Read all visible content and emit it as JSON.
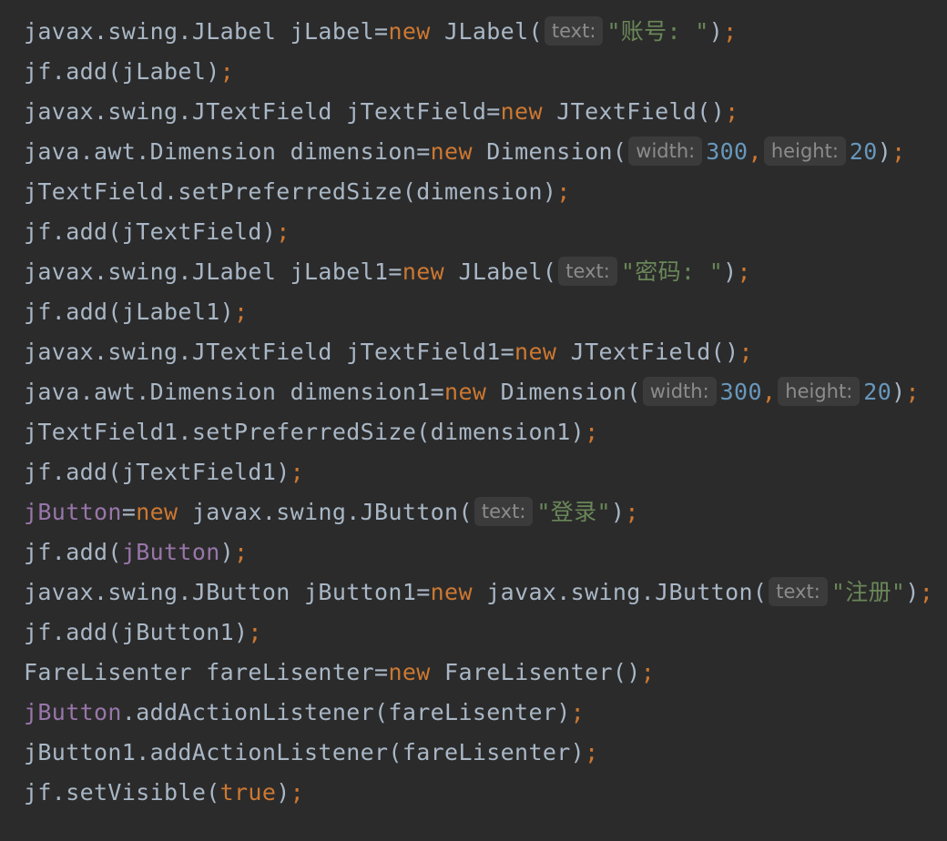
{
  "editor": {
    "lines": [
      [
        {
          "t": "code",
          "text": "javax.swing.JLabel jLabel=",
          "color": "#a9b7c6"
        },
        {
          "t": "code",
          "text": "new",
          "color": "#cc7832"
        },
        {
          "t": "code",
          "text": " JLabel(",
          "color": "#a9b7c6"
        },
        {
          "t": "hint",
          "text": "text:"
        },
        {
          "t": "code",
          "text": "\"账号: \"",
          "color": "#6a8759"
        },
        {
          "t": "code",
          "text": ")",
          "color": "#a9b7c6"
        },
        {
          "t": "code",
          "text": ";",
          "color": "#cc7832"
        }
      ],
      [
        {
          "t": "code",
          "text": "jf.add(jLabel)",
          "color": "#a9b7c6"
        },
        {
          "t": "code",
          "text": ";",
          "color": "#cc7832"
        }
      ],
      [
        {
          "t": "code",
          "text": "javax.swing.JTextField jTextField=",
          "color": "#a9b7c6"
        },
        {
          "t": "code",
          "text": "new",
          "color": "#cc7832"
        },
        {
          "t": "code",
          "text": " JTextField()",
          "color": "#a9b7c6"
        },
        {
          "t": "code",
          "text": ";",
          "color": "#cc7832"
        }
      ],
      [
        {
          "t": "code",
          "text": "java.awt.Dimension dimension=",
          "color": "#a9b7c6"
        },
        {
          "t": "code",
          "text": "new",
          "color": "#cc7832"
        },
        {
          "t": "code",
          "text": " Dimension(",
          "color": "#a9b7c6"
        },
        {
          "t": "hint",
          "text": "width:"
        },
        {
          "t": "code",
          "text": "300",
          "color": "#6897bb"
        },
        {
          "t": "code",
          "text": ",",
          "color": "#cc7832"
        },
        {
          "t": "hint",
          "text": "height:"
        },
        {
          "t": "code",
          "text": "20",
          "color": "#6897bb"
        },
        {
          "t": "code",
          "text": ")",
          "color": "#a9b7c6"
        },
        {
          "t": "code",
          "text": ";",
          "color": "#cc7832"
        }
      ],
      [
        {
          "t": "code",
          "text": "jTextField.setPreferredSize(dimension)",
          "color": "#a9b7c6"
        },
        {
          "t": "code",
          "text": ";",
          "color": "#cc7832"
        }
      ],
      [
        {
          "t": "code",
          "text": "jf.add(jTextField)",
          "color": "#a9b7c6"
        },
        {
          "t": "code",
          "text": ";",
          "color": "#cc7832"
        }
      ],
      [
        {
          "t": "code",
          "text": "javax.swing.JLabel jLabel1=",
          "color": "#a9b7c6"
        },
        {
          "t": "code",
          "text": "new",
          "color": "#cc7832"
        },
        {
          "t": "code",
          "text": " JLabel(",
          "color": "#a9b7c6"
        },
        {
          "t": "hint",
          "text": "text:"
        },
        {
          "t": "code",
          "text": "\"密码: \"",
          "color": "#6a8759"
        },
        {
          "t": "code",
          "text": ")",
          "color": "#a9b7c6"
        },
        {
          "t": "code",
          "text": ";",
          "color": "#cc7832"
        }
      ],
      [
        {
          "t": "code",
          "text": "jf.add(jLabel1)",
          "color": "#a9b7c6"
        },
        {
          "t": "code",
          "text": ";",
          "color": "#cc7832"
        }
      ],
      [
        {
          "t": "code",
          "text": "javax.swing.JTextField jTextField1=",
          "color": "#a9b7c6"
        },
        {
          "t": "code",
          "text": "new",
          "color": "#cc7832"
        },
        {
          "t": "code",
          "text": " JTextField()",
          "color": "#a9b7c6"
        },
        {
          "t": "code",
          "text": ";",
          "color": "#cc7832"
        }
      ],
      [
        {
          "t": "code",
          "text": "java.awt.Dimension dimension1=",
          "color": "#a9b7c6"
        },
        {
          "t": "code",
          "text": "new",
          "color": "#cc7832"
        },
        {
          "t": "code",
          "text": " Dimension(",
          "color": "#a9b7c6"
        },
        {
          "t": "hint",
          "text": "width:"
        },
        {
          "t": "code",
          "text": "300",
          "color": "#6897bb"
        },
        {
          "t": "code",
          "text": ",",
          "color": "#cc7832"
        },
        {
          "t": "hint",
          "text": "height:"
        },
        {
          "t": "code",
          "text": "20",
          "color": "#6897bb"
        },
        {
          "t": "code",
          "text": ")",
          "color": "#a9b7c6"
        },
        {
          "t": "code",
          "text": ";",
          "color": "#cc7832"
        }
      ],
      [
        {
          "t": "code",
          "text": "jTextField1.setPreferredSize(dimension1)",
          "color": "#a9b7c6"
        },
        {
          "t": "code",
          "text": ";",
          "color": "#cc7832"
        }
      ],
      [
        {
          "t": "code",
          "text": "jf.add(jTextField1)",
          "color": "#a9b7c6"
        },
        {
          "t": "code",
          "text": ";",
          "color": "#cc7832"
        }
      ],
      [
        {
          "t": "code",
          "text": "jButton",
          "color": "#9876aa"
        },
        {
          "t": "code",
          "text": "=",
          "color": "#a9b7c6"
        },
        {
          "t": "code",
          "text": "new",
          "color": "#cc7832"
        },
        {
          "t": "code",
          "text": " javax.swing.JButton(",
          "color": "#a9b7c6"
        },
        {
          "t": "hint",
          "text": "text:"
        },
        {
          "t": "code",
          "text": "\"登录\"",
          "color": "#6a8759"
        },
        {
          "t": "code",
          "text": ")",
          "color": "#a9b7c6"
        },
        {
          "t": "code",
          "text": ";",
          "color": "#cc7832"
        }
      ],
      [
        {
          "t": "code",
          "text": "jf.add(",
          "color": "#a9b7c6"
        },
        {
          "t": "code",
          "text": "jButton",
          "color": "#9876aa"
        },
        {
          "t": "code",
          "text": ")",
          "color": "#a9b7c6"
        },
        {
          "t": "code",
          "text": ";",
          "color": "#cc7832"
        }
      ],
      [
        {
          "t": "code",
          "text": "javax.swing.JButton jButton1=",
          "color": "#a9b7c6"
        },
        {
          "t": "code",
          "text": "new",
          "color": "#cc7832"
        },
        {
          "t": "code",
          "text": " javax.swing.JButton(",
          "color": "#a9b7c6"
        },
        {
          "t": "hint",
          "text": "text:"
        },
        {
          "t": "code",
          "text": "\"注册\"",
          "color": "#6a8759"
        },
        {
          "t": "code",
          "text": ")",
          "color": "#a9b7c6"
        },
        {
          "t": "code",
          "text": ";",
          "color": "#cc7832"
        }
      ],
      [
        {
          "t": "code",
          "text": "jf.add(jButton1)",
          "color": "#a9b7c6"
        },
        {
          "t": "code",
          "text": ";",
          "color": "#cc7832"
        }
      ],
      [
        {
          "t": "code",
          "text": "FareLisenter fareLisenter=",
          "color": "#a9b7c6"
        },
        {
          "t": "code",
          "text": "new",
          "color": "#cc7832"
        },
        {
          "t": "code",
          "text": " FareLisenter()",
          "color": "#a9b7c6"
        },
        {
          "t": "code",
          "text": ";",
          "color": "#cc7832"
        }
      ],
      [
        {
          "t": "code",
          "text": "jButton",
          "color": "#9876aa"
        },
        {
          "t": "code",
          "text": ".addActionListener(fareLisenter)",
          "color": "#a9b7c6"
        },
        {
          "t": "code",
          "text": ";",
          "color": "#cc7832"
        }
      ],
      [
        {
          "t": "code",
          "text": "jButton1.addActionListener(fareLisenter)",
          "color": "#a9b7c6"
        },
        {
          "t": "code",
          "text": ";",
          "color": "#cc7832"
        }
      ],
      [
        {
          "t": "code",
          "text": "jf.setVisible(",
          "color": "#a9b7c6"
        },
        {
          "t": "code",
          "text": "true",
          "color": "#cc7832"
        },
        {
          "t": "code",
          "text": ")",
          "color": "#a9b7c6"
        },
        {
          "t": "code",
          "text": ";",
          "color": "#cc7832"
        }
      ]
    ]
  }
}
